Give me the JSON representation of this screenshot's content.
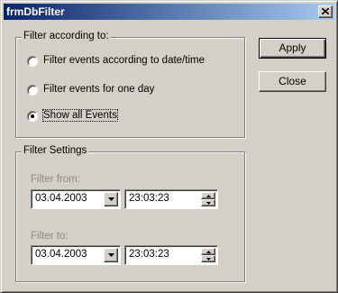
{
  "window": {
    "title": "frmDbFilter",
    "close_icon": "close-icon"
  },
  "filter_group": {
    "legend": "Filter according to:",
    "options": [
      {
        "label": "Filter events according to date/time",
        "checked": false
      },
      {
        "label": "Filter events for one day",
        "checked": false
      },
      {
        "label": "Show all Events",
        "checked": true
      }
    ]
  },
  "settings_group": {
    "legend": "Filter Settings",
    "from_label": "Filter from:",
    "from_date": "03.04.2003",
    "from_time": "23:03:23",
    "to_label": "Filter to:",
    "to_date": "03.04.2003",
    "to_time": "23:03:23",
    "dropdown_icon": "chevron-down-icon",
    "spin_up_icon": "spin-up-icon",
    "spin_down_icon": "spin-down-icon"
  },
  "buttons": {
    "apply": "Apply",
    "close": "Close"
  },
  "colors": {
    "title_gradient_start": "#0a246a",
    "title_gradient_end": "#a6caf0",
    "face": "#d4d0c8",
    "disabled_text": "#8e8a82"
  }
}
